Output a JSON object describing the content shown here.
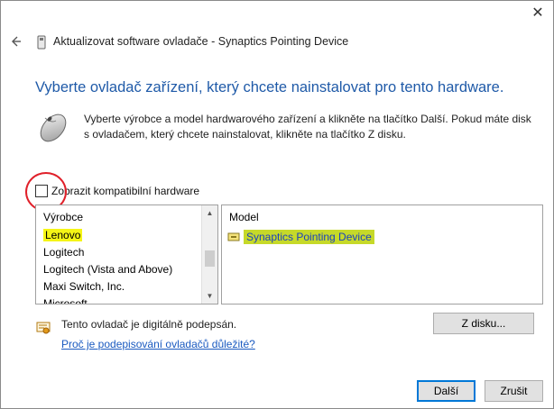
{
  "window": {
    "close_glyph": "✕",
    "title": "Aktualizovat software ovladače - Synaptics Pointing Device"
  },
  "heading": "Vyberte ovladač zařízení, který chcete nainstalovat pro tento hardware.",
  "description": "Vyberte výrobce a model hardwarového zařízení a klikněte na tlačítko Další. Pokud máte disk s ovladačem, který chcete nainstalovat, klikněte na tlačítko Z disku.",
  "compatible": {
    "label": "Zobrazit kompatibilní hardware",
    "checked": false
  },
  "manufacturers": {
    "header": "Výrobce",
    "items": [
      "Lenovo",
      "Logitech",
      "Logitech (Vista and Above)",
      "Maxi Switch, Inc.",
      "Microsoft"
    ],
    "highlighted": "Lenovo"
  },
  "models": {
    "header": "Model",
    "items": [
      "Synaptics Pointing Device"
    ],
    "selected": "Synaptics Pointing Device"
  },
  "signature": {
    "text": "Tento ovladač je digitálně podepsán.",
    "link": "Proč je podepisování ovladačů důležité?"
  },
  "buttons": {
    "disk": "Z disku...",
    "next": "Další",
    "cancel": "Zrušit"
  },
  "colors": {
    "heading": "#1f5aa8",
    "link": "#1a5ac0",
    "highlight": "#f5f516",
    "annotation_circle": "#e0202a"
  },
  "icons": {
    "back": "back-arrow-icon",
    "device": "device-icon",
    "mouse": "mouse-icon",
    "certificate": "certificate-icon"
  }
}
